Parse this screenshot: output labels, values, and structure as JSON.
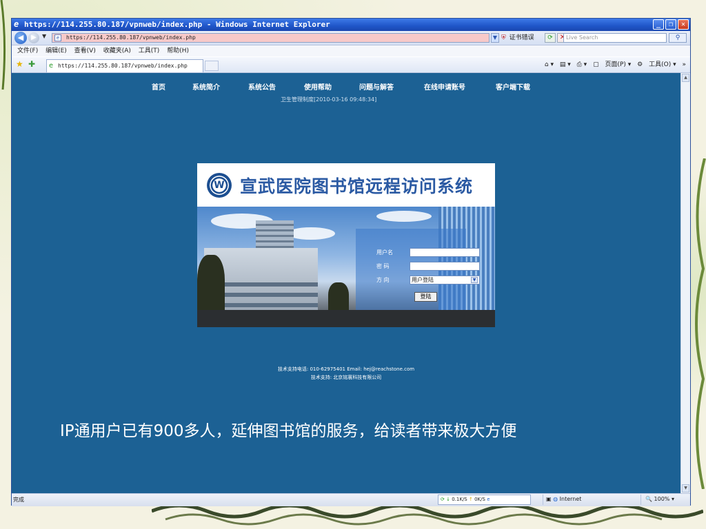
{
  "window": {
    "title": "https://114.255.80.187/vpnweb/index.php - Windows Internet Explorer"
  },
  "address_bar": {
    "url": "https://114.255.80.187/vpnweb/index.php",
    "cert_error": "证书错误",
    "search_placeholder": "Live Search"
  },
  "menu": [
    "文件(F)",
    "编辑(E)",
    "查看(V)",
    "收藏夹(A)",
    "工具(T)",
    "帮助(H)"
  ],
  "tab": {
    "title": "https://114.255.80.187/vpnweb/index.php"
  },
  "command_bar": {
    "page_label": "页面(P)",
    "tools_label": "工具(O)"
  },
  "site_nav": [
    "首页",
    "系统简介",
    "系统公告",
    "使用帮助",
    "问题与解答",
    "在线申请账号",
    "客户端下载"
  ],
  "marquee": {
    "line1": "卫生管理制度[2010-03-16 09:48:34]"
  },
  "login": {
    "system_title": "宣武医院图书馆远程访问系统",
    "emblem_letter": "W",
    "username_label": "用户名",
    "password_label": "密  码",
    "mode_label": "方  向",
    "mode_value": "用户登陆",
    "submit_label": "登陆"
  },
  "footer": {
    "support_line1": "技术支持电话: 010-62975401 Email: hej@reachstone.com",
    "support_line2": "技术支持: 北京铭寰科技有限公司"
  },
  "caption": "IP通用户已有900多人，延伸图书馆的服务，给读者带来极大方便",
  "status": {
    "text": "完成",
    "download_speed": "0.1K/S",
    "upload_speed": "0K/S",
    "zone": "Internet",
    "zoom": "100%"
  },
  "colors": {
    "page_bg": "#1c6194",
    "title_text": "#2b5aa3",
    "url_error_bg": "#f7c9c9"
  }
}
